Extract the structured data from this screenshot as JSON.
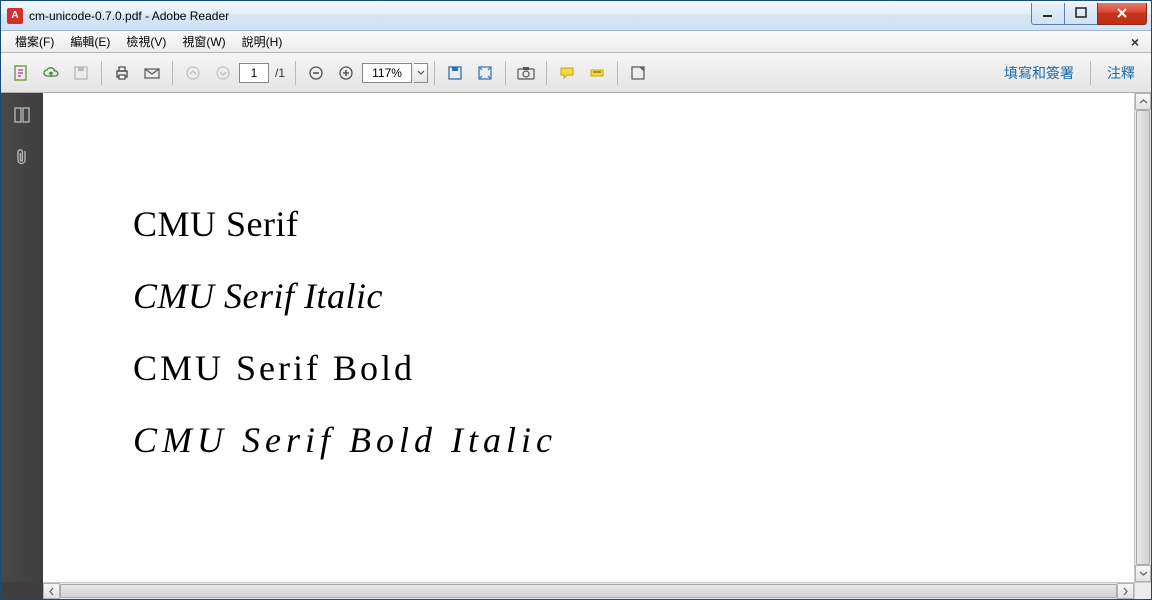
{
  "window": {
    "title": "cm-unicode-0.7.0.pdf - Adobe Reader"
  },
  "menu": {
    "file": "檔案(F)",
    "edit": "編輯(E)",
    "view": "檢視(V)",
    "window": "視窗(W)",
    "help": "說明(H)"
  },
  "toolbar": {
    "page_current": "1",
    "page_total": "/1",
    "zoom": "117%",
    "fill_sign": "填寫和簽署",
    "comment": "注釋"
  },
  "document": {
    "lines": [
      {
        "text": "CMU Serif",
        "cls": "s1"
      },
      {
        "text": "CMU Serif Italic",
        "cls": "s2"
      },
      {
        "text": "CMU Serif Bold",
        "cls": "s3"
      },
      {
        "text": "CMU Serif Bold Italic",
        "cls": "s4"
      }
    ]
  }
}
